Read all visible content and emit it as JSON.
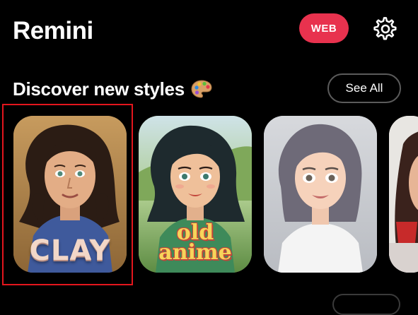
{
  "header": {
    "app_title": "Remini",
    "web_button_label": "WEB",
    "settings_icon": "gear-icon"
  },
  "section": {
    "title": "Discover new styles",
    "title_icon": "artist-palette-icon",
    "see_all_label": "See All"
  },
  "styles": [
    {
      "label": "CLAY",
      "selected": true
    },
    {
      "label_line1": "old",
      "label_line2": "anime"
    },
    {
      "label": ""
    },
    {
      "label": ""
    }
  ],
  "colors": {
    "background": "#000000",
    "accent": "#e8324e",
    "selection_outline": "#e3161d",
    "text": "#ffffff"
  }
}
